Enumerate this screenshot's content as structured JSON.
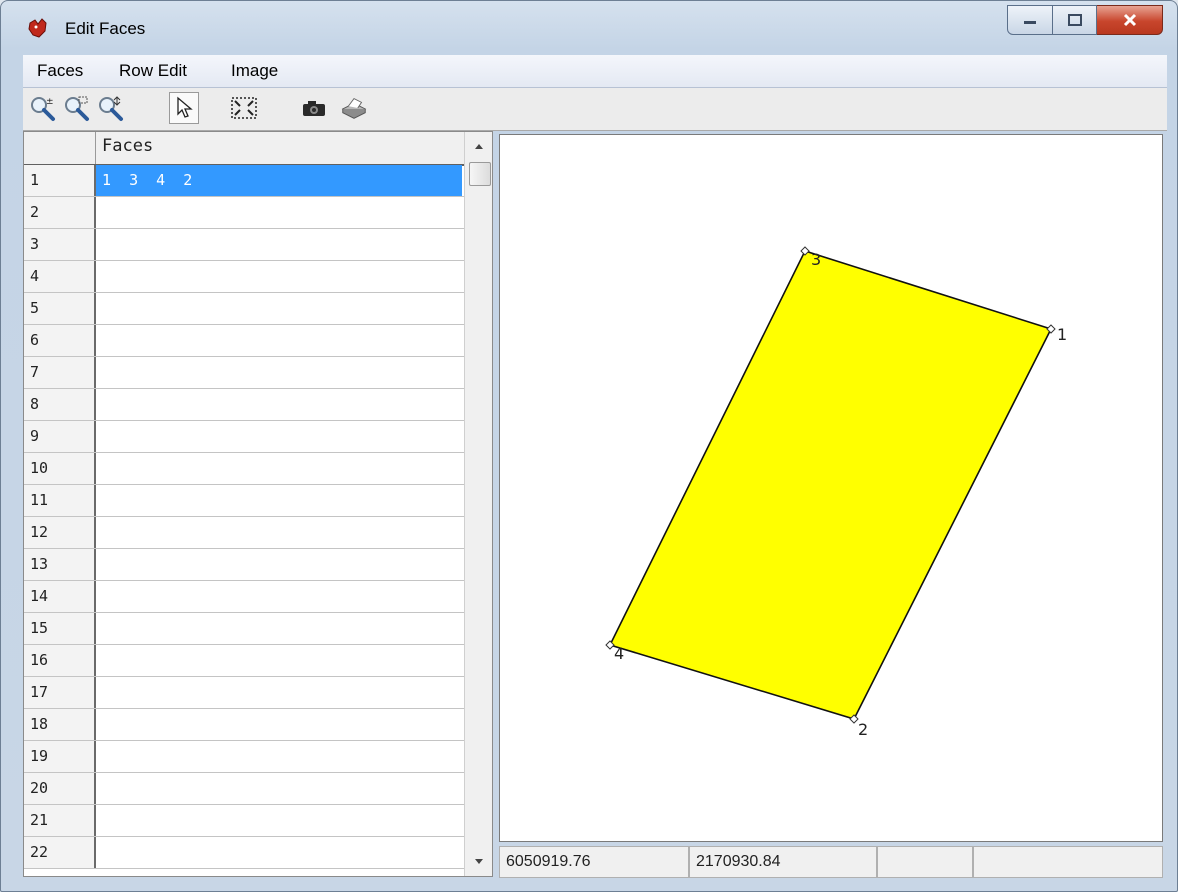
{
  "window": {
    "title": "Edit Faces"
  },
  "menu": [
    "Faces",
    "Row Edit",
    "Image"
  ],
  "toolbar": [
    {
      "name": "zoom-in-out-icon"
    },
    {
      "name": "zoom-window-icon"
    },
    {
      "name": "zoom-pan-icon"
    },
    {
      "name": "select-pointer-icon",
      "pressed": true
    },
    {
      "name": "zoom-extents-icon"
    },
    {
      "name": "camera-icon"
    },
    {
      "name": "printer-icon"
    }
  ],
  "grid": {
    "column_header": "Faces",
    "rows": [
      {
        "num": "1",
        "value": "1  3  4  2",
        "selected": true
      },
      {
        "num": "2",
        "value": ""
      },
      {
        "num": "3",
        "value": ""
      },
      {
        "num": "4",
        "value": ""
      },
      {
        "num": "5",
        "value": ""
      },
      {
        "num": "6",
        "value": ""
      },
      {
        "num": "7",
        "value": ""
      },
      {
        "num": "8",
        "value": ""
      },
      {
        "num": "9",
        "value": ""
      },
      {
        "num": "10",
        "value": ""
      },
      {
        "num": "11",
        "value": ""
      },
      {
        "num": "12",
        "value": ""
      },
      {
        "num": "13",
        "value": ""
      },
      {
        "num": "14",
        "value": ""
      },
      {
        "num": "15",
        "value": ""
      },
      {
        "num": "16",
        "value": ""
      },
      {
        "num": "17",
        "value": ""
      },
      {
        "num": "18",
        "value": ""
      },
      {
        "num": "19",
        "value": ""
      },
      {
        "num": "20",
        "value": ""
      },
      {
        "num": "21",
        "value": ""
      },
      {
        "num": "22",
        "value": ""
      }
    ]
  },
  "canvas": {
    "fill_color": "#ffff00",
    "vertex_labels": [
      "1",
      "2",
      "3",
      "4"
    ]
  },
  "status": {
    "x_coord": "6050919.76",
    "y_coord": "2170930.84",
    "cell3": "",
    "cell4": ""
  }
}
